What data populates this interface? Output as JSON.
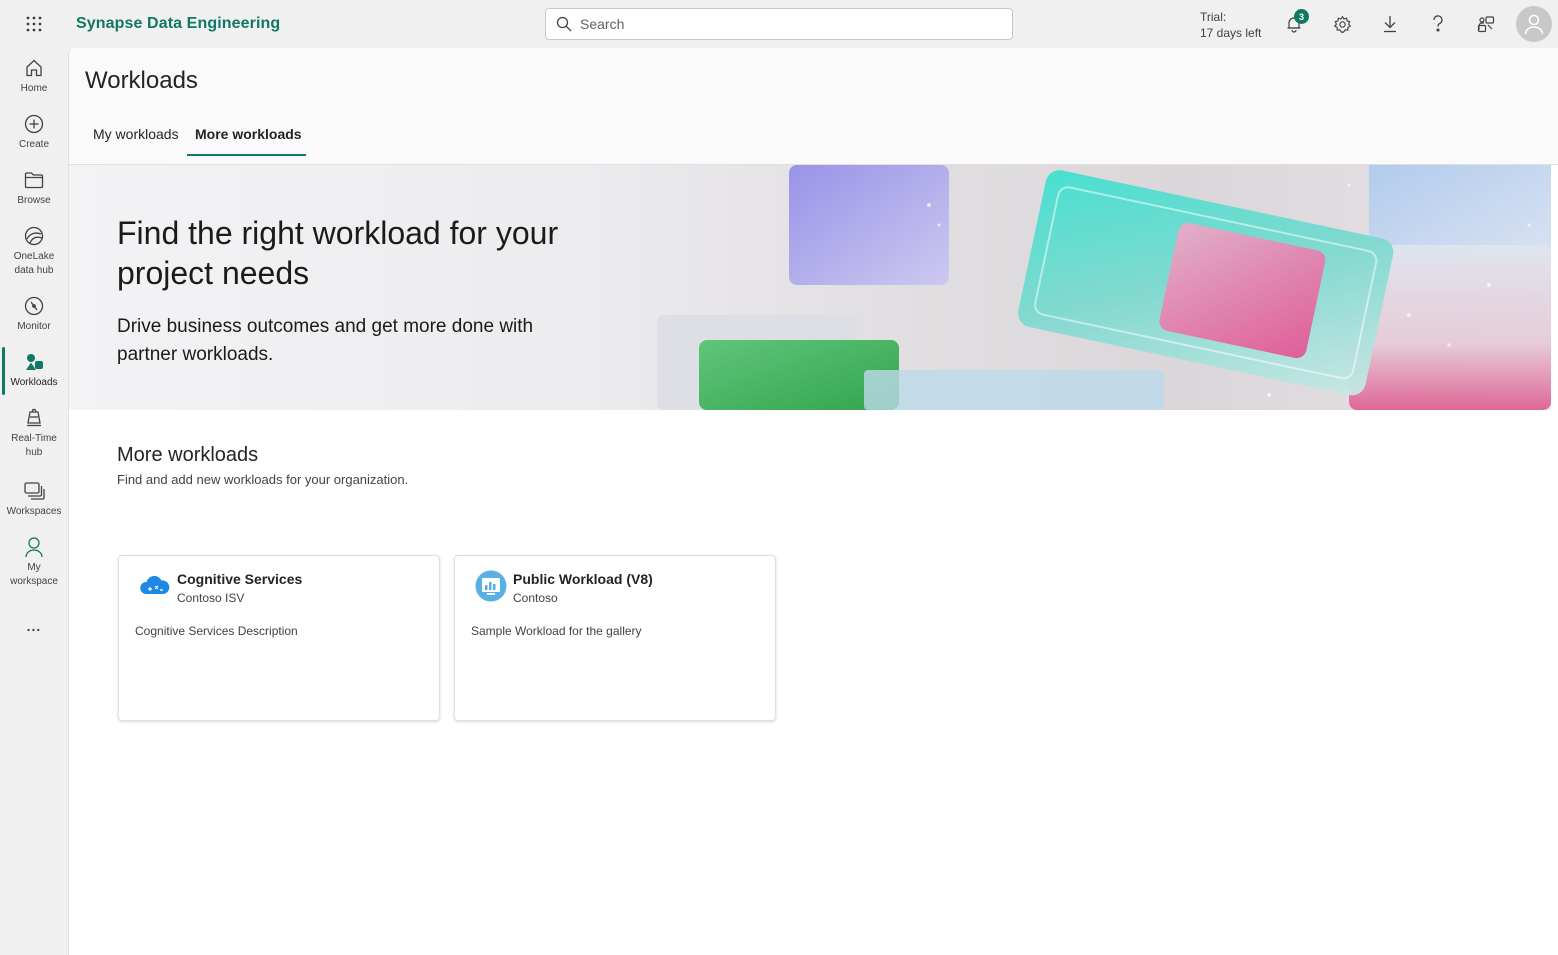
{
  "app": {
    "title": "Synapse Data Engineering",
    "accent_color": "#117865"
  },
  "search": {
    "placeholder": "Search"
  },
  "header_right": {
    "trial_label": "Trial:",
    "trial_days": "17 days left",
    "notification_count": "3",
    "icons": [
      "bell-icon",
      "gear-icon",
      "download-icon",
      "help-icon",
      "share-icon",
      "avatar"
    ]
  },
  "leftnav": {
    "items": [
      {
        "label": "Home",
        "icon": "home-icon"
      },
      {
        "label": "Create",
        "icon": "plus-circle-icon"
      },
      {
        "label": "Browse",
        "icon": "folder-icon"
      },
      {
        "label": "OneLake data hub",
        "icon": "onelake-icon"
      },
      {
        "label": "Monitor",
        "icon": "monitor-icon"
      },
      {
        "label": "Workloads",
        "icon": "workloads-icon",
        "active": true
      },
      {
        "label": "Real-Time hub",
        "icon": "realtime-icon"
      },
      {
        "label": "Workspaces",
        "icon": "workspaces-icon"
      },
      {
        "label": "My workspace",
        "icon": "person-icon"
      }
    ],
    "more_label": "..."
  },
  "page": {
    "title": "Workloads",
    "tabs": [
      {
        "label": "My workloads",
        "active": false
      },
      {
        "label": "More workloads",
        "active": true
      }
    ]
  },
  "hero": {
    "title": "Find the right workload for your project needs",
    "subtitle": "Drive business outcomes and get more done with partner workloads."
  },
  "section": {
    "title": "More workloads",
    "subtitle": "Find and add new workloads for your organization."
  },
  "cards": [
    {
      "name": "Cognitive Services",
      "publisher": "Contoso ISV",
      "description": "Cognitive Services Description",
      "icon": "cloud-icon"
    },
    {
      "name": "Public Workload (V8)",
      "publisher": "Contoso",
      "description": "Sample Workload for the gallery",
      "icon": "chart-icon"
    }
  ]
}
